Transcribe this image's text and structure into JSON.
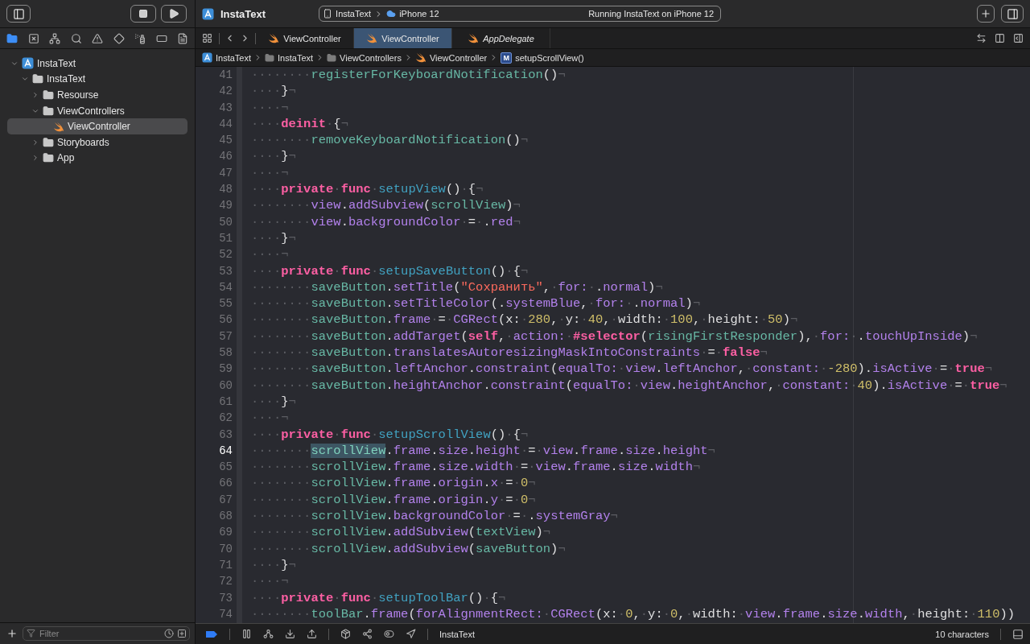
{
  "toolbar": {
    "project": "InstaText",
    "scheme": {
      "target": "InstaText",
      "device": "iPhone 12"
    },
    "status": "Running InstaText on iPhone 12"
  },
  "navigator": {
    "tabs": [
      {
        "kind": "files",
        "selected": true
      },
      {
        "kind": "source",
        "selected": false
      },
      {
        "kind": "symbols",
        "selected": false
      },
      {
        "kind": "search",
        "selected": false
      },
      {
        "kind": "issues",
        "selected": false
      },
      {
        "kind": "tests",
        "selected": false
      },
      {
        "kind": "debug",
        "selected": false
      },
      {
        "kind": "breakpoints",
        "selected": false
      },
      {
        "kind": "reports",
        "selected": false
      }
    ],
    "tree": [
      {
        "label": "InstaText",
        "kind": "project",
        "expanded": true,
        "selected": false,
        "children": [
          {
            "label": "InstaText",
            "kind": "folder",
            "expanded": true,
            "selected": false,
            "children": [
              {
                "label": "Resourse",
                "kind": "folder",
                "expanded": false,
                "selected": false
              },
              {
                "label": "ViewControllers",
                "kind": "folder",
                "expanded": true,
                "selected": false,
                "children": [
                  {
                    "label": "ViewController",
                    "kind": "swift",
                    "selected": true
                  }
                ]
              },
              {
                "label": "Storyboards",
                "kind": "folder",
                "expanded": false,
                "selected": false
              },
              {
                "label": "App",
                "kind": "folder",
                "expanded": false,
                "selected": false
              }
            ]
          }
        ]
      }
    ],
    "filter": {
      "placeholder": "Filter"
    }
  },
  "editor": {
    "tabs": [
      {
        "label": "ViewController",
        "selected": false,
        "preview": false
      },
      {
        "label": "ViewController",
        "selected": true,
        "preview": false
      },
      {
        "label": "AppDelegate",
        "selected": false,
        "preview": true
      }
    ],
    "breadcrumb": [
      {
        "label": "InstaText",
        "kind": "project"
      },
      {
        "label": "InstaText",
        "kind": "folder"
      },
      {
        "label": "ViewControllers",
        "kind": "folder"
      },
      {
        "label": "ViewController",
        "kind": "swift"
      },
      {
        "label": "setupScrollView()",
        "kind": "method",
        "badge": "M"
      }
    ],
    "lines": [
      {
        "number": "41",
        "current": false,
        "tokens": [
          {
            "kind": "ws",
            "text": "········"
          },
          {
            "kind": "pr",
            "text": "registerForKeyboardNotification"
          },
          {
            "kind": "p",
            "text": "()"
          },
          {
            "kind": "ws",
            "text": "¬"
          }
        ]
      },
      {
        "number": "42",
        "current": false,
        "tokens": [
          {
            "kind": "ws",
            "text": "····"
          },
          {
            "kind": "p",
            "text": "}"
          },
          {
            "kind": "ws",
            "text": "¬"
          }
        ]
      },
      {
        "number": "43",
        "current": false,
        "tokens": [
          {
            "kind": "ws",
            "text": "····¬"
          }
        ]
      },
      {
        "number": "44",
        "current": false,
        "tokens": [
          {
            "kind": "ws",
            "text": "····"
          },
          {
            "kind": "kw",
            "text": "deinit"
          },
          {
            "kind": "ws",
            "text": "·"
          },
          {
            "kind": "p",
            "text": "{"
          },
          {
            "kind": "ws",
            "text": "¬"
          }
        ]
      },
      {
        "number": "45",
        "current": false,
        "tokens": [
          {
            "kind": "ws",
            "text": "········"
          },
          {
            "kind": "pr",
            "text": "removeKeyboardNotification"
          },
          {
            "kind": "p",
            "text": "()"
          },
          {
            "kind": "ws",
            "text": "¬"
          }
        ]
      },
      {
        "number": "46",
        "current": false,
        "tokens": [
          {
            "kind": "ws",
            "text": "····"
          },
          {
            "kind": "p",
            "text": "}"
          },
          {
            "kind": "ws",
            "text": "¬"
          }
        ]
      },
      {
        "number": "47",
        "current": false,
        "tokens": [
          {
            "kind": "ws",
            "text": "····¬"
          }
        ]
      },
      {
        "number": "48",
        "current": false,
        "tokens": [
          {
            "kind": "ws",
            "text": "····"
          },
          {
            "kind": "kw",
            "text": "private"
          },
          {
            "kind": "ws",
            "text": "·"
          },
          {
            "kind": "kw",
            "text": "func"
          },
          {
            "kind": "ws",
            "text": "·"
          },
          {
            "kind": "fd",
            "text": "setupView"
          },
          {
            "kind": "p",
            "text": "()"
          },
          {
            "kind": "ws",
            "text": "·"
          },
          {
            "kind": "p",
            "text": "{"
          },
          {
            "kind": "ws",
            "text": "¬"
          }
        ]
      },
      {
        "number": "49",
        "current": false,
        "tokens": [
          {
            "kind": "ws",
            "text": "········"
          },
          {
            "kind": "o",
            "text": "view"
          },
          {
            "kind": "p",
            "text": "."
          },
          {
            "kind": "o",
            "text": "addSubview"
          },
          {
            "kind": "p",
            "text": "("
          },
          {
            "kind": "pr",
            "text": "scrollView"
          },
          {
            "kind": "p",
            "text": ")"
          },
          {
            "kind": "ws",
            "text": "¬"
          }
        ]
      },
      {
        "number": "50",
        "current": false,
        "tokens": [
          {
            "kind": "ws",
            "text": "········"
          },
          {
            "kind": "o",
            "text": "view"
          },
          {
            "kind": "p",
            "text": "."
          },
          {
            "kind": "o",
            "text": "backgroundColor"
          },
          {
            "kind": "ws",
            "text": "·"
          },
          {
            "kind": "p",
            "text": "="
          },
          {
            "kind": "ws",
            "text": "·"
          },
          {
            "kind": "p",
            "text": "."
          },
          {
            "kind": "o",
            "text": "red"
          },
          {
            "kind": "ws",
            "text": "¬"
          }
        ]
      },
      {
        "number": "51",
        "current": false,
        "tokens": [
          {
            "kind": "ws",
            "text": "····"
          },
          {
            "kind": "p",
            "text": "}"
          },
          {
            "kind": "ws",
            "text": "¬"
          }
        ]
      },
      {
        "number": "52",
        "current": false,
        "tokens": [
          {
            "kind": "ws",
            "text": "····¬"
          }
        ]
      },
      {
        "number": "53",
        "current": false,
        "tokens": [
          {
            "kind": "ws",
            "text": "····"
          },
          {
            "kind": "kw",
            "text": "private"
          },
          {
            "kind": "ws",
            "text": "·"
          },
          {
            "kind": "kw",
            "text": "func"
          },
          {
            "kind": "ws",
            "text": "·"
          },
          {
            "kind": "fd",
            "text": "setupSaveButton"
          },
          {
            "kind": "p",
            "text": "()"
          },
          {
            "kind": "ws",
            "text": "·"
          },
          {
            "kind": "p",
            "text": "{"
          },
          {
            "kind": "ws",
            "text": "¬"
          }
        ]
      },
      {
        "number": "54",
        "current": false,
        "tokens": [
          {
            "kind": "ws",
            "text": "········"
          },
          {
            "kind": "pr",
            "text": "saveButton"
          },
          {
            "kind": "p",
            "text": "."
          },
          {
            "kind": "o",
            "text": "setTitle"
          },
          {
            "kind": "p",
            "text": "("
          },
          {
            "kind": "s",
            "text": "\"Сохранить\""
          },
          {
            "kind": "p",
            "text": ","
          },
          {
            "kind": "ws",
            "text": "·"
          },
          {
            "kind": "o",
            "text": "for:"
          },
          {
            "kind": "ws",
            "text": "·"
          },
          {
            "kind": "p",
            "text": "."
          },
          {
            "kind": "o",
            "text": "normal"
          },
          {
            "kind": "p",
            "text": ")"
          },
          {
            "kind": "ws",
            "text": "¬"
          }
        ]
      },
      {
        "number": "55",
        "current": false,
        "tokens": [
          {
            "kind": "ws",
            "text": "········"
          },
          {
            "kind": "pr",
            "text": "saveButton"
          },
          {
            "kind": "p",
            "text": "."
          },
          {
            "kind": "o",
            "text": "setTitleColor"
          },
          {
            "kind": "p",
            "text": "(."
          },
          {
            "kind": "o",
            "text": "systemBlue"
          },
          {
            "kind": "p",
            "text": ","
          },
          {
            "kind": "ws",
            "text": "·"
          },
          {
            "kind": "o",
            "text": "for:"
          },
          {
            "kind": "ws",
            "text": "·"
          },
          {
            "kind": "p",
            "text": "."
          },
          {
            "kind": "o",
            "text": "normal"
          },
          {
            "kind": "p",
            "text": ")"
          },
          {
            "kind": "ws",
            "text": "¬"
          }
        ]
      },
      {
        "number": "56",
        "current": false,
        "tokens": [
          {
            "kind": "ws",
            "text": "········"
          },
          {
            "kind": "pr",
            "text": "saveButton"
          },
          {
            "kind": "p",
            "text": "."
          },
          {
            "kind": "o",
            "text": "frame"
          },
          {
            "kind": "ws",
            "text": "·"
          },
          {
            "kind": "p",
            "text": "="
          },
          {
            "kind": "ws",
            "text": "·"
          },
          {
            "kind": "o",
            "text": "CGRect"
          },
          {
            "kind": "p",
            "text": "(x:"
          },
          {
            "kind": "ws",
            "text": "·"
          },
          {
            "kind": "n",
            "text": "280"
          },
          {
            "kind": "p",
            "text": ","
          },
          {
            "kind": "ws",
            "text": "·"
          },
          {
            "kind": "p",
            "text": "y:"
          },
          {
            "kind": "ws",
            "text": "·"
          },
          {
            "kind": "n",
            "text": "40"
          },
          {
            "kind": "p",
            "text": ","
          },
          {
            "kind": "ws",
            "text": "·"
          },
          {
            "kind": "p",
            "text": "width:"
          },
          {
            "kind": "ws",
            "text": "·"
          },
          {
            "kind": "n",
            "text": "100"
          },
          {
            "kind": "p",
            "text": ","
          },
          {
            "kind": "ws",
            "text": "·"
          },
          {
            "kind": "p",
            "text": "height:"
          },
          {
            "kind": "ws",
            "text": "·"
          },
          {
            "kind": "n",
            "text": "50"
          },
          {
            "kind": "p",
            "text": ")"
          },
          {
            "kind": "ws",
            "text": "¬"
          }
        ]
      },
      {
        "number": "57",
        "current": false,
        "tokens": [
          {
            "kind": "ws",
            "text": "········"
          },
          {
            "kind": "pr",
            "text": "saveButton"
          },
          {
            "kind": "p",
            "text": "."
          },
          {
            "kind": "o",
            "text": "addTarget"
          },
          {
            "kind": "p",
            "text": "("
          },
          {
            "kind": "kw",
            "text": "self"
          },
          {
            "kind": "p",
            "text": ","
          },
          {
            "kind": "ws",
            "text": "·"
          },
          {
            "kind": "o",
            "text": "action:"
          },
          {
            "kind": "ws",
            "text": "·"
          },
          {
            "kind": "kw",
            "text": "#selector"
          },
          {
            "kind": "p",
            "text": "("
          },
          {
            "kind": "pr",
            "text": "risingFirstResponder"
          },
          {
            "kind": "p",
            "text": "),"
          },
          {
            "kind": "ws",
            "text": "·"
          },
          {
            "kind": "o",
            "text": "for:"
          },
          {
            "kind": "ws",
            "text": "·"
          },
          {
            "kind": "p",
            "text": "."
          },
          {
            "kind": "o",
            "text": "touchUpInside"
          },
          {
            "kind": "p",
            "text": ")"
          },
          {
            "kind": "ws",
            "text": "¬"
          }
        ]
      },
      {
        "number": "58",
        "current": false,
        "tokens": [
          {
            "kind": "ws",
            "text": "········"
          },
          {
            "kind": "pr",
            "text": "saveButton"
          },
          {
            "kind": "p",
            "text": "."
          },
          {
            "kind": "o",
            "text": "translatesAutoresizingMaskIntoConstraints"
          },
          {
            "kind": "ws",
            "text": "·"
          },
          {
            "kind": "p",
            "text": "="
          },
          {
            "kind": "ws",
            "text": "·"
          },
          {
            "kind": "kw",
            "text": "false"
          },
          {
            "kind": "ws",
            "text": "¬"
          }
        ]
      },
      {
        "number": "59",
        "current": false,
        "tokens": [
          {
            "kind": "ws",
            "text": "········"
          },
          {
            "kind": "pr",
            "text": "saveButton"
          },
          {
            "kind": "p",
            "text": "."
          },
          {
            "kind": "o",
            "text": "leftAnchor"
          },
          {
            "kind": "p",
            "text": "."
          },
          {
            "kind": "o",
            "text": "constraint"
          },
          {
            "kind": "p",
            "text": "("
          },
          {
            "kind": "o",
            "text": "equalTo:"
          },
          {
            "kind": "ws",
            "text": "·"
          },
          {
            "kind": "o",
            "text": "view"
          },
          {
            "kind": "p",
            "text": "."
          },
          {
            "kind": "o",
            "text": "leftAnchor"
          },
          {
            "kind": "p",
            "text": ","
          },
          {
            "kind": "ws",
            "text": "·"
          },
          {
            "kind": "o",
            "text": "constant:"
          },
          {
            "kind": "ws",
            "text": "·"
          },
          {
            "kind": "n",
            "text": "-280"
          },
          {
            "kind": "p",
            "text": ")."
          },
          {
            "kind": "o",
            "text": "isActive"
          },
          {
            "kind": "ws",
            "text": "·"
          },
          {
            "kind": "p",
            "text": "="
          },
          {
            "kind": "ws",
            "text": "·"
          },
          {
            "kind": "kw",
            "text": "true"
          },
          {
            "kind": "ws",
            "text": "¬"
          }
        ]
      },
      {
        "number": "60",
        "current": false,
        "tokens": [
          {
            "kind": "ws",
            "text": "········"
          },
          {
            "kind": "pr",
            "text": "saveButton"
          },
          {
            "kind": "p",
            "text": "."
          },
          {
            "kind": "o",
            "text": "heightAnchor"
          },
          {
            "kind": "p",
            "text": "."
          },
          {
            "kind": "o",
            "text": "constraint"
          },
          {
            "kind": "p",
            "text": "("
          },
          {
            "kind": "o",
            "text": "equalTo:"
          },
          {
            "kind": "ws",
            "text": "·"
          },
          {
            "kind": "o",
            "text": "view"
          },
          {
            "kind": "p",
            "text": "."
          },
          {
            "kind": "o",
            "text": "heightAnchor"
          },
          {
            "kind": "p",
            "text": ","
          },
          {
            "kind": "ws",
            "text": "·"
          },
          {
            "kind": "o",
            "text": "constant:"
          },
          {
            "kind": "ws",
            "text": "·"
          },
          {
            "kind": "n",
            "text": "40"
          },
          {
            "kind": "p",
            "text": ")."
          },
          {
            "kind": "o",
            "text": "isActive"
          },
          {
            "kind": "ws",
            "text": "·"
          },
          {
            "kind": "p",
            "text": "="
          },
          {
            "kind": "ws",
            "text": "·"
          },
          {
            "kind": "kw",
            "text": "true"
          },
          {
            "kind": "ws",
            "text": "¬"
          }
        ]
      },
      {
        "number": "61",
        "current": false,
        "tokens": [
          {
            "kind": "ws",
            "text": "····"
          },
          {
            "kind": "p",
            "text": "}"
          },
          {
            "kind": "ws",
            "text": "¬"
          }
        ]
      },
      {
        "number": "62",
        "current": false,
        "tokens": [
          {
            "kind": "ws",
            "text": "····¬"
          }
        ]
      },
      {
        "number": "63",
        "current": false,
        "tokens": [
          {
            "kind": "ws",
            "text": "····"
          },
          {
            "kind": "kw",
            "text": "private"
          },
          {
            "kind": "ws",
            "text": "·"
          },
          {
            "kind": "kw",
            "text": "func"
          },
          {
            "kind": "ws",
            "text": "·"
          },
          {
            "kind": "fd",
            "text": "setupScrollView"
          },
          {
            "kind": "p",
            "text": "()"
          },
          {
            "kind": "ws",
            "text": "·"
          },
          {
            "kind": "p",
            "text": "{"
          },
          {
            "kind": "ws",
            "text": "¬"
          }
        ]
      },
      {
        "number": "64",
        "current": true,
        "tokens": [
          {
            "kind": "ws",
            "text": "········"
          },
          {
            "kind": "hl",
            "text": "scrollView"
          },
          {
            "kind": "p",
            "text": "."
          },
          {
            "kind": "o",
            "text": "frame"
          },
          {
            "kind": "p",
            "text": "."
          },
          {
            "kind": "o",
            "text": "size"
          },
          {
            "kind": "p",
            "text": "."
          },
          {
            "kind": "o",
            "text": "height"
          },
          {
            "kind": "ws",
            "text": "·"
          },
          {
            "kind": "p",
            "text": "="
          },
          {
            "kind": "ws",
            "text": "·"
          },
          {
            "kind": "o",
            "text": "view"
          },
          {
            "kind": "p",
            "text": "."
          },
          {
            "kind": "o",
            "text": "frame"
          },
          {
            "kind": "p",
            "text": "."
          },
          {
            "kind": "o",
            "text": "size"
          },
          {
            "kind": "p",
            "text": "."
          },
          {
            "kind": "o",
            "text": "height"
          },
          {
            "kind": "ws",
            "text": "¬"
          }
        ]
      },
      {
        "number": "65",
        "current": false,
        "tokens": [
          {
            "kind": "ws",
            "text": "········"
          },
          {
            "kind": "pr",
            "text": "scrollView"
          },
          {
            "kind": "p",
            "text": "."
          },
          {
            "kind": "o",
            "text": "frame"
          },
          {
            "kind": "p",
            "text": "."
          },
          {
            "kind": "o",
            "text": "size"
          },
          {
            "kind": "p",
            "text": "."
          },
          {
            "kind": "o",
            "text": "width"
          },
          {
            "kind": "ws",
            "text": "·"
          },
          {
            "kind": "p",
            "text": "="
          },
          {
            "kind": "ws",
            "text": "·"
          },
          {
            "kind": "o",
            "text": "view"
          },
          {
            "kind": "p",
            "text": "."
          },
          {
            "kind": "o",
            "text": "frame"
          },
          {
            "kind": "p",
            "text": "."
          },
          {
            "kind": "o",
            "text": "size"
          },
          {
            "kind": "p",
            "text": "."
          },
          {
            "kind": "o",
            "text": "width"
          },
          {
            "kind": "ws",
            "text": "¬"
          }
        ]
      },
      {
        "number": "66",
        "current": false,
        "tokens": [
          {
            "kind": "ws",
            "text": "········"
          },
          {
            "kind": "pr",
            "text": "scrollView"
          },
          {
            "kind": "p",
            "text": "."
          },
          {
            "kind": "o",
            "text": "frame"
          },
          {
            "kind": "p",
            "text": "."
          },
          {
            "kind": "o",
            "text": "origin"
          },
          {
            "kind": "p",
            "text": "."
          },
          {
            "kind": "o",
            "text": "x"
          },
          {
            "kind": "ws",
            "text": "·"
          },
          {
            "kind": "p",
            "text": "="
          },
          {
            "kind": "ws",
            "text": "·"
          },
          {
            "kind": "n",
            "text": "0"
          },
          {
            "kind": "ws",
            "text": "¬"
          }
        ]
      },
      {
        "number": "67",
        "current": false,
        "tokens": [
          {
            "kind": "ws",
            "text": "········"
          },
          {
            "kind": "pr",
            "text": "scrollView"
          },
          {
            "kind": "p",
            "text": "."
          },
          {
            "kind": "o",
            "text": "frame"
          },
          {
            "kind": "p",
            "text": "."
          },
          {
            "kind": "o",
            "text": "origin"
          },
          {
            "kind": "p",
            "text": "."
          },
          {
            "kind": "o",
            "text": "y"
          },
          {
            "kind": "ws",
            "text": "·"
          },
          {
            "kind": "p",
            "text": "="
          },
          {
            "kind": "ws",
            "text": "·"
          },
          {
            "kind": "n",
            "text": "0"
          },
          {
            "kind": "ws",
            "text": "¬"
          }
        ]
      },
      {
        "number": "68",
        "current": false,
        "tokens": [
          {
            "kind": "ws",
            "text": "········"
          },
          {
            "kind": "pr",
            "text": "scrollView"
          },
          {
            "kind": "p",
            "text": "."
          },
          {
            "kind": "o",
            "text": "backgroundColor"
          },
          {
            "kind": "ws",
            "text": "·"
          },
          {
            "kind": "p",
            "text": "="
          },
          {
            "kind": "ws",
            "text": "·"
          },
          {
            "kind": "p",
            "text": "."
          },
          {
            "kind": "o",
            "text": "systemGray"
          },
          {
            "kind": "ws",
            "text": "¬"
          }
        ]
      },
      {
        "number": "69",
        "current": false,
        "tokens": [
          {
            "kind": "ws",
            "text": "········"
          },
          {
            "kind": "pr",
            "text": "scrollView"
          },
          {
            "kind": "p",
            "text": "."
          },
          {
            "kind": "o",
            "text": "addSubview"
          },
          {
            "kind": "p",
            "text": "("
          },
          {
            "kind": "pr",
            "text": "textView"
          },
          {
            "kind": "p",
            "text": ")"
          },
          {
            "kind": "ws",
            "text": "¬"
          }
        ]
      },
      {
        "number": "70",
        "current": false,
        "tokens": [
          {
            "kind": "ws",
            "text": "········"
          },
          {
            "kind": "pr",
            "text": "scrollView"
          },
          {
            "kind": "p",
            "text": "."
          },
          {
            "kind": "o",
            "text": "addSubview"
          },
          {
            "kind": "p",
            "text": "("
          },
          {
            "kind": "pr",
            "text": "saveButton"
          },
          {
            "kind": "p",
            "text": ")"
          },
          {
            "kind": "ws",
            "text": "¬"
          }
        ]
      },
      {
        "number": "71",
        "current": false,
        "tokens": [
          {
            "kind": "ws",
            "text": "····"
          },
          {
            "kind": "p",
            "text": "}"
          },
          {
            "kind": "ws",
            "text": "¬"
          }
        ]
      },
      {
        "number": "72",
        "current": false,
        "tokens": [
          {
            "kind": "ws",
            "text": "····¬"
          }
        ]
      },
      {
        "number": "73",
        "current": false,
        "tokens": [
          {
            "kind": "ws",
            "text": "····"
          },
          {
            "kind": "kw",
            "text": "private"
          },
          {
            "kind": "ws",
            "text": "·"
          },
          {
            "kind": "kw",
            "text": "func"
          },
          {
            "kind": "ws",
            "text": "·"
          },
          {
            "kind": "fd",
            "text": "setupToolBar"
          },
          {
            "kind": "p",
            "text": "()"
          },
          {
            "kind": "ws",
            "text": "·"
          },
          {
            "kind": "p",
            "text": "{"
          },
          {
            "kind": "ws",
            "text": "¬"
          }
        ]
      },
      {
        "number": "74",
        "current": false,
        "tokens": [
          {
            "kind": "ws",
            "text": "········"
          },
          {
            "kind": "pr",
            "text": "toolBar"
          },
          {
            "kind": "p",
            "text": "."
          },
          {
            "kind": "o",
            "text": "frame"
          },
          {
            "kind": "p",
            "text": "("
          },
          {
            "kind": "o",
            "text": "forAlignmentRect:"
          },
          {
            "kind": "ws",
            "text": "·"
          },
          {
            "kind": "o",
            "text": "CGRect"
          },
          {
            "kind": "p",
            "text": "(x:"
          },
          {
            "kind": "ws",
            "text": "·"
          },
          {
            "kind": "n",
            "text": "0"
          },
          {
            "kind": "p",
            "text": ","
          },
          {
            "kind": "ws",
            "text": "·"
          },
          {
            "kind": "p",
            "text": "y:"
          },
          {
            "kind": "ws",
            "text": "·"
          },
          {
            "kind": "n",
            "text": "0"
          },
          {
            "kind": "p",
            "text": ","
          },
          {
            "kind": "ws",
            "text": "·"
          },
          {
            "kind": "p",
            "text": "width:"
          },
          {
            "kind": "ws",
            "text": "·"
          },
          {
            "kind": "o",
            "text": "view"
          },
          {
            "kind": "p",
            "text": "."
          },
          {
            "kind": "o",
            "text": "frame"
          },
          {
            "kind": "p",
            "text": "."
          },
          {
            "kind": "o",
            "text": "size"
          },
          {
            "kind": "p",
            "text": "."
          },
          {
            "kind": "o",
            "text": "width"
          },
          {
            "kind": "p",
            "text": ","
          },
          {
            "kind": "ws",
            "text": "·"
          },
          {
            "kind": "p",
            "text": "height:"
          },
          {
            "kind": "ws",
            "text": "·"
          },
          {
            "kind": "n",
            "text": "110"
          },
          {
            "kind": "p",
            "text": "))"
          }
        ]
      }
    ]
  },
  "debug_bar": {
    "scheme": "InstaText"
  },
  "status_bar": {
    "selection": "10 characters"
  }
}
